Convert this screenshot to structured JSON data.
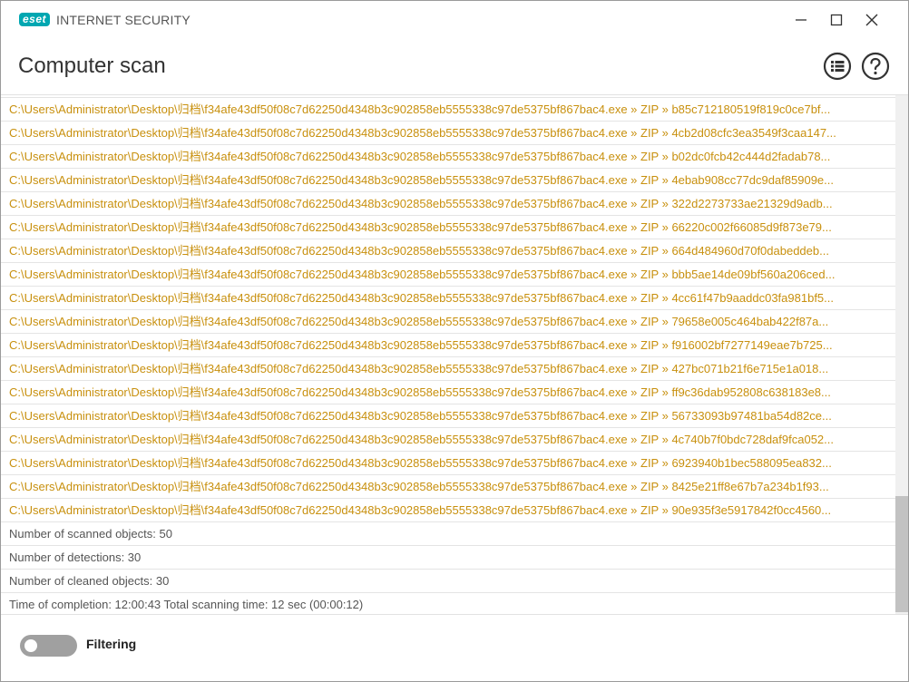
{
  "app": {
    "brand_badge": "eset",
    "product_name": "INTERNET SECURITY"
  },
  "window_controls": {
    "minimize": "minimize-icon",
    "maximize": "maximize-icon",
    "close": "close-icon"
  },
  "header": {
    "title": "Computer scan",
    "list_icon": "list-icon",
    "help_icon": "help-icon"
  },
  "log": {
    "detections": [
      "C:\\Users\\Administrator\\Desktop\\归档\\f34afe43df50f08c7d62250d4348b3c902858eb5555338c97de5375bf867bac4.exe » ZIP » b85c712180519f819c0ce7bf...",
      "C:\\Users\\Administrator\\Desktop\\归档\\f34afe43df50f08c7d62250d4348b3c902858eb5555338c97de5375bf867bac4.exe » ZIP » 4cb2d08cfc3ea3549f3caa147...",
      "C:\\Users\\Administrator\\Desktop\\归档\\f34afe43df50f08c7d62250d4348b3c902858eb5555338c97de5375bf867bac4.exe » ZIP » b02dc0fcb42c444d2fadab78...",
      "C:\\Users\\Administrator\\Desktop\\归档\\f34afe43df50f08c7d62250d4348b3c902858eb5555338c97de5375bf867bac4.exe » ZIP » 4ebab908cc77dc9daf85909e...",
      "C:\\Users\\Administrator\\Desktop\\归档\\f34afe43df50f08c7d62250d4348b3c902858eb5555338c97de5375bf867bac4.exe » ZIP » 322d2273733ae21329d9adb...",
      "C:\\Users\\Administrator\\Desktop\\归档\\f34afe43df50f08c7d62250d4348b3c902858eb5555338c97de5375bf867bac4.exe » ZIP » 66220c002f66085d9f873e79...",
      "C:\\Users\\Administrator\\Desktop\\归档\\f34afe43df50f08c7d62250d4348b3c902858eb5555338c97de5375bf867bac4.exe » ZIP » 664d484960d70f0dabeddeb...",
      "C:\\Users\\Administrator\\Desktop\\归档\\f34afe43df50f08c7d62250d4348b3c902858eb5555338c97de5375bf867bac4.exe » ZIP » bbb5ae14de09bf560a206ced...",
      "C:\\Users\\Administrator\\Desktop\\归档\\f34afe43df50f08c7d62250d4348b3c902858eb5555338c97de5375bf867bac4.exe » ZIP » 4cc61f47b9aaddc03fa981bf5...",
      "C:\\Users\\Administrator\\Desktop\\归档\\f34afe43df50f08c7d62250d4348b3c902858eb5555338c97de5375bf867bac4.exe » ZIP » 79658e005c464bab422f87a...",
      "C:\\Users\\Administrator\\Desktop\\归档\\f34afe43df50f08c7d62250d4348b3c902858eb5555338c97de5375bf867bac4.exe » ZIP » f916002bf7277149eae7b725...",
      "C:\\Users\\Administrator\\Desktop\\归档\\f34afe43df50f08c7d62250d4348b3c902858eb5555338c97de5375bf867bac4.exe » ZIP » 427bc071b21f6e715e1a018...",
      "C:\\Users\\Administrator\\Desktop\\归档\\f34afe43df50f08c7d62250d4348b3c902858eb5555338c97de5375bf867bac4.exe » ZIP » ff9c36dab952808c638183e8...",
      "C:\\Users\\Administrator\\Desktop\\归档\\f34afe43df50f08c7d62250d4348b3c902858eb5555338c97de5375bf867bac4.exe » ZIP » 56733093b97481ba54d82ce...",
      "C:\\Users\\Administrator\\Desktop\\归档\\f34afe43df50f08c7d62250d4348b3c902858eb5555338c97de5375bf867bac4.exe » ZIP » 4c740b7f0bdc728daf9fca052...",
      "C:\\Users\\Administrator\\Desktop\\归档\\f34afe43df50f08c7d62250d4348b3c902858eb5555338c97de5375bf867bac4.exe » ZIP » 6923940b1bec588095ea832...",
      "C:\\Users\\Administrator\\Desktop\\归档\\f34afe43df50f08c7d62250d4348b3c902858eb5555338c97de5375bf867bac4.exe » ZIP » 8425e21ff8e67b7a234b1f93...",
      "C:\\Users\\Administrator\\Desktop\\归档\\f34afe43df50f08c7d62250d4348b3c902858eb5555338c97de5375bf867bac4.exe » ZIP » 90e935f3e5917842f0cc4560..."
    ],
    "stats": [
      "Number of scanned objects: 50",
      "Number of detections: 30",
      "Number of cleaned objects: 30",
      "Time of completion: 12:00:43  Total scanning time: 12 sec (00:00:12)"
    ]
  },
  "footer": {
    "filter_label": "Filtering",
    "filter_enabled": false
  },
  "colors": {
    "brand": "#00a7b1",
    "detection_text": "#c8900e",
    "stat_text": "#555555",
    "toggle_off": "#a0a0a0"
  }
}
